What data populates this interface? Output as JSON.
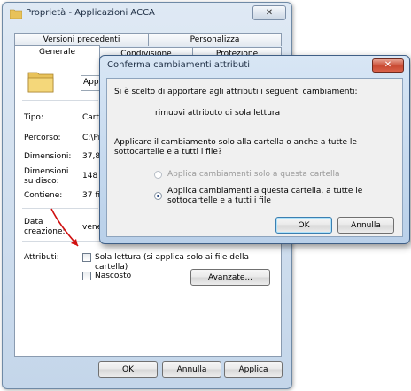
{
  "window": {
    "title": "Proprietà - Applicazioni ACCA",
    "close_glyph": "✕"
  },
  "tabs": {
    "row1": [
      "Versioni precedenti",
      "Personalizza"
    ],
    "row2": [
      "Generale",
      "Condivisione",
      "Protezione"
    ]
  },
  "general": {
    "name_value": "Appli",
    "rows": [
      {
        "label": "Tipo:",
        "value": "Carte"
      },
      {
        "label": "Percorso:",
        "value": "C:\\Pr"
      },
      {
        "label": "Dimensioni:",
        "value": "37,8"
      },
      {
        "label": "Dimensioni su disco:",
        "value": "148 K"
      },
      {
        "label": "Contiene:",
        "value": "37 file"
      },
      {
        "label": "Data creazione:",
        "value": "vener"
      }
    ],
    "attributes_label": "Attributi:",
    "readonly_label": "Sola lettura (si applica solo ai file della cartella)",
    "hidden_label": "Nascosto",
    "advanced_button": "Avanzate..."
  },
  "footer": {
    "ok": "OK",
    "cancel": "Annulla",
    "apply": "Applica"
  },
  "dialog": {
    "title": "Conferma cambiamenti attributi",
    "close_glyph": "✕",
    "intro": "Si è scelto di apportare agli attributi i seguenti cambiamenti:",
    "change": "rimuovi attributo di sola lettura",
    "question": "Applicare il cambiamento solo alla cartella o anche a tutte le sottocartelle e a tutti i file?",
    "option1": "Applica cambiamenti solo a questa cartella",
    "option2": "Applica cambiamenti a questa cartella, a tutte le sottocartelle e a tutti i file",
    "option1_selected": false,
    "option2_selected": true,
    "ok": "OK",
    "cancel": "Annulla"
  },
  "colors": {
    "annotation_arrow": "#d01010",
    "close_button": "#c94a32",
    "folder": "#e8c25a"
  },
  "icons": [
    "folder-icon",
    "close-icon",
    "red-arrow-annotation"
  ]
}
